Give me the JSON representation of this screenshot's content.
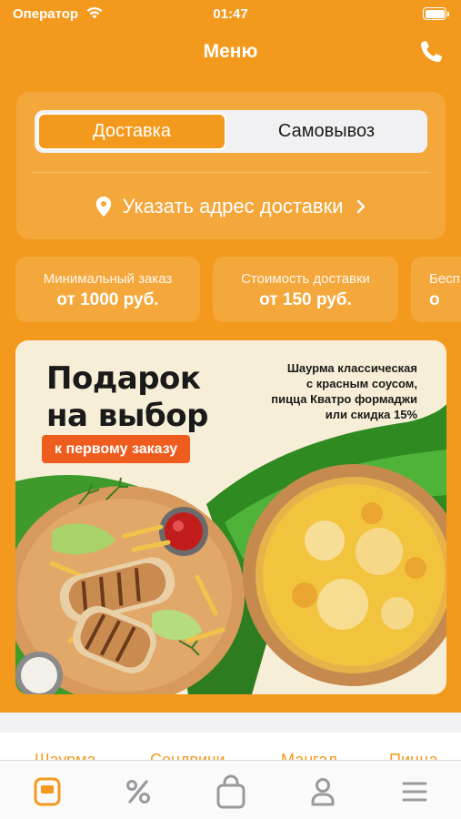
{
  "status_bar": {
    "carrier": "Оператор",
    "time": "01:47"
  },
  "header": {
    "title": "Меню",
    "phone_icon": "phone-icon"
  },
  "delivery": {
    "tabs": [
      {
        "label": "Доставка",
        "selected": true
      },
      {
        "label": "Самовывоз",
        "selected": false
      }
    ],
    "address_label": "Указать адрес доставки"
  },
  "info_chips": [
    {
      "label": "Минимальный заказ",
      "value": "от 1000 руб."
    },
    {
      "label": "Стоимость доставки",
      "value": "от 150 руб."
    },
    {
      "label": "Бесп",
      "value": "о"
    }
  ],
  "banner": {
    "title_line1": "Подарок",
    "title_line2": "на выбор",
    "subtitle": "к первому заказу",
    "desc_line1": "Шаурма классическая",
    "desc_line2": "с красным соусом,",
    "desc_line3": "пицца Кватро формаджи",
    "desc_line4": "или скидка 15%"
  },
  "categories": [
    "Шаурма",
    "Сендвичи",
    "Мангал",
    "Пицца"
  ],
  "tabbar": {
    "items": [
      {
        "icon": "menu-icon",
        "active": true
      },
      {
        "icon": "percent-icon",
        "active": false
      },
      {
        "icon": "cart-icon",
        "active": false
      },
      {
        "icon": "profile-icon",
        "active": false
      },
      {
        "icon": "hamburger-icon",
        "active": false
      }
    ]
  },
  "colors": {
    "accent": "#f39a1e",
    "promo": "#ef5d1e",
    "inactive_icon": "#9a9a9e"
  }
}
